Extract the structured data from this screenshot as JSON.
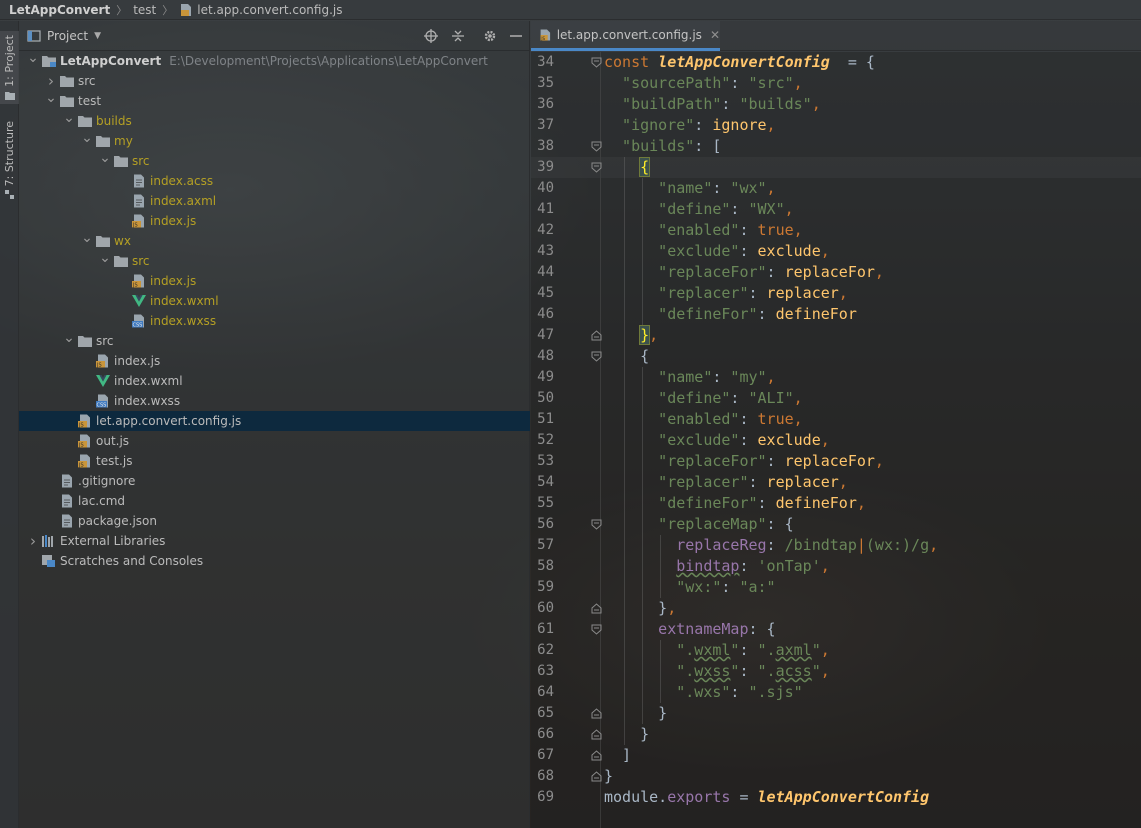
{
  "navbar": {
    "project": "LetAppConvert",
    "folder": "test",
    "file": "let.app.convert.config.js"
  },
  "toolstrip": {
    "project_tab": "1: Project",
    "structure_tab": "7: Structure"
  },
  "project_panel": {
    "title": "Project",
    "icons": [
      "locate-icon",
      "collapse-icon",
      "gear-icon",
      "minimize-icon"
    ],
    "tree": [
      {
        "label": "LetAppConvert",
        "path": "E:\\Development\\Projects\\Applications\\LetAppConvert",
        "type": "project",
        "depth": 0,
        "arrow": "down"
      },
      {
        "label": "src",
        "type": "folder",
        "depth": 1,
        "arrow": "right"
      },
      {
        "label": "test",
        "type": "folder",
        "depth": 1,
        "arrow": "down"
      },
      {
        "label": "builds",
        "type": "folder-excluded",
        "depth": 2,
        "arrow": "down"
      },
      {
        "label": "my",
        "type": "folder-excluded",
        "depth": 3,
        "arrow": "down"
      },
      {
        "label": "src",
        "type": "folder-excluded",
        "depth": 4,
        "arrow": "down"
      },
      {
        "label": "index.acss",
        "type": "file-excluded",
        "depth": 5
      },
      {
        "label": "index.axml",
        "type": "file-excluded",
        "depth": 5
      },
      {
        "label": "index.js",
        "type": "js-excluded",
        "depth": 5
      },
      {
        "label": "wx",
        "type": "folder-excluded",
        "depth": 3,
        "arrow": "down"
      },
      {
        "label": "src",
        "type": "folder-excluded",
        "depth": 4,
        "arrow": "down"
      },
      {
        "label": "index.js",
        "type": "js-excluded",
        "depth": 5
      },
      {
        "label": "index.wxml",
        "type": "vue-excluded",
        "depth": 5
      },
      {
        "label": "index.wxss",
        "type": "css-excluded",
        "depth": 5
      },
      {
        "label": "src",
        "type": "folder",
        "depth": 2,
        "arrow": "down"
      },
      {
        "label": "index.js",
        "type": "js",
        "depth": 3
      },
      {
        "label": "index.wxml",
        "type": "vue",
        "depth": 3
      },
      {
        "label": "index.wxss",
        "type": "css",
        "depth": 3
      },
      {
        "label": "let.app.convert.config.js",
        "type": "js",
        "depth": 2,
        "selected": true
      },
      {
        "label": "out.js",
        "type": "js",
        "depth": 2
      },
      {
        "label": "test.js",
        "type": "js",
        "depth": 2
      },
      {
        "label": ".gitignore",
        "type": "file",
        "depth": 1
      },
      {
        "label": "lac.cmd",
        "type": "file",
        "depth": 1
      },
      {
        "label": "package.json",
        "type": "file",
        "depth": 1
      },
      {
        "label": "External Libraries",
        "type": "libraries",
        "depth": 0,
        "arrow": "right"
      },
      {
        "label": "Scratches and Consoles",
        "type": "scratches",
        "depth": 0
      }
    ]
  },
  "editor": {
    "tab_label": "let.app.convert.config.js",
    "current_line": 39,
    "lines": [
      {
        "n": "34",
        "indent": 0,
        "fold": "open",
        "tokens": [
          [
            "k",
            "const "
          ],
          [
            "f",
            "letAppConvertConfig"
          ],
          [
            "",
            "  = {"
          ]
        ]
      },
      {
        "n": "35",
        "indent": 1,
        "tokens": [
          [
            "s",
            "\"sourcePath\""
          ],
          [
            "",
            ": "
          ],
          [
            "s",
            "\"src\""
          ],
          [
            "k",
            ","
          ]
        ]
      },
      {
        "n": "36",
        "indent": 1,
        "tokens": [
          [
            "s",
            "\"buildPath\""
          ],
          [
            "",
            ": "
          ],
          [
            "s",
            "\"builds\""
          ],
          [
            "k",
            ","
          ]
        ]
      },
      {
        "n": "37",
        "indent": 1,
        "tokens": [
          [
            "s",
            "\"ignore\""
          ],
          [
            "",
            ": "
          ],
          [
            "id",
            "ignore"
          ],
          [
            "k",
            ","
          ]
        ]
      },
      {
        "n": "38",
        "indent": 1,
        "fold": "open",
        "tokens": [
          [
            "s",
            "\"builds\""
          ],
          [
            "",
            ": ["
          ]
        ]
      },
      {
        "n": "39",
        "indent": 2,
        "fold": "open",
        "tokens": [
          [
            "hl",
            "{"
          ]
        ]
      },
      {
        "n": "40",
        "indent": 3,
        "tokens": [
          [
            "s",
            "\"name\""
          ],
          [
            "",
            ": "
          ],
          [
            "s",
            "\"wx\""
          ],
          [
            "k",
            ","
          ]
        ]
      },
      {
        "n": "41",
        "indent": 3,
        "tokens": [
          [
            "s",
            "\"define\""
          ],
          [
            "",
            ": "
          ],
          [
            "s",
            "\"WX\""
          ],
          [
            "k",
            ","
          ]
        ]
      },
      {
        "n": "42",
        "indent": 3,
        "tokens": [
          [
            "s",
            "\"enabled\""
          ],
          [
            "",
            ": "
          ],
          [
            "k",
            "true"
          ],
          [
            "k",
            ","
          ]
        ]
      },
      {
        "n": "43",
        "indent": 3,
        "tokens": [
          [
            "s",
            "\"exclude\""
          ],
          [
            "",
            ": "
          ],
          [
            "id",
            "exclude"
          ],
          [
            "k",
            ","
          ]
        ]
      },
      {
        "n": "44",
        "indent": 3,
        "tokens": [
          [
            "s",
            "\"replaceFor\""
          ],
          [
            "",
            ": "
          ],
          [
            "id",
            "replaceFor"
          ],
          [
            "k",
            ","
          ]
        ]
      },
      {
        "n": "45",
        "indent": 3,
        "tokens": [
          [
            "s",
            "\"replacer\""
          ],
          [
            "",
            ": "
          ],
          [
            "id",
            "replacer"
          ],
          [
            "k",
            ","
          ]
        ]
      },
      {
        "n": "46",
        "indent": 3,
        "tokens": [
          [
            "s",
            "\"defineFor\""
          ],
          [
            "",
            ": "
          ],
          [
            "id",
            "defineFor"
          ]
        ]
      },
      {
        "n": "47",
        "indent": 2,
        "fold": "close",
        "tokens": [
          [
            "hl",
            "}"
          ],
          [
            "k",
            ","
          ]
        ]
      },
      {
        "n": "48",
        "indent": 2,
        "fold": "open",
        "tokens": [
          [
            "",
            "{"
          ]
        ]
      },
      {
        "n": "49",
        "indent": 3,
        "tokens": [
          [
            "s",
            "\"name\""
          ],
          [
            "",
            ": "
          ],
          [
            "s",
            "\"my\""
          ],
          [
            "k",
            ","
          ]
        ]
      },
      {
        "n": "50",
        "indent": 3,
        "tokens": [
          [
            "s",
            "\"define\""
          ],
          [
            "",
            ": "
          ],
          [
            "s",
            "\"ALI\""
          ],
          [
            "k",
            ","
          ]
        ]
      },
      {
        "n": "51",
        "indent": 3,
        "tokens": [
          [
            "s",
            "\"enabled\""
          ],
          [
            "",
            ": "
          ],
          [
            "k",
            "true"
          ],
          [
            "k",
            ","
          ]
        ]
      },
      {
        "n": "52",
        "indent": 3,
        "tokens": [
          [
            "s",
            "\"exclude\""
          ],
          [
            "",
            ": "
          ],
          [
            "id",
            "exclude"
          ],
          [
            "k",
            ","
          ]
        ]
      },
      {
        "n": "53",
        "indent": 3,
        "tokens": [
          [
            "s",
            "\"replaceFor\""
          ],
          [
            "",
            ": "
          ],
          [
            "id",
            "replaceFor"
          ],
          [
            "k",
            ","
          ]
        ]
      },
      {
        "n": "54",
        "indent": 3,
        "tokens": [
          [
            "s",
            "\"replacer\""
          ],
          [
            "",
            ": "
          ],
          [
            "id",
            "replacer"
          ],
          [
            "k",
            ","
          ]
        ]
      },
      {
        "n": "55",
        "indent": 3,
        "tokens": [
          [
            "s",
            "\"defineFor\""
          ],
          [
            "",
            ": "
          ],
          [
            "id",
            "defineFor"
          ],
          [
            "k",
            ","
          ]
        ]
      },
      {
        "n": "56",
        "indent": 3,
        "fold": "open",
        "tokens": [
          [
            "s",
            "\"replaceMap\""
          ],
          [
            "",
            ": {"
          ]
        ]
      },
      {
        "n": "57",
        "indent": 4,
        "tokens": [
          [
            "pl",
            "replaceReg"
          ],
          [
            "",
            ": "
          ],
          [
            "rx",
            "/bindtap"
          ],
          [
            "rxb",
            "|"
          ],
          [
            "rx",
            "(wx:)/g"
          ],
          [
            "k",
            ","
          ]
        ]
      },
      {
        "n": "58",
        "indent": 4,
        "tokens": [
          [
            "pl sq",
            "bindtap"
          ],
          [
            "",
            ": "
          ],
          [
            "s",
            "'onTap'"
          ],
          [
            "k",
            ","
          ]
        ]
      },
      {
        "n": "59",
        "indent": 4,
        "tokens": [
          [
            "s",
            "\"wx:\""
          ],
          [
            "",
            ": "
          ],
          [
            "s",
            "\"a:\""
          ]
        ]
      },
      {
        "n": "60",
        "indent": 3,
        "fold": "close",
        "tokens": [
          [
            "",
            "}"
          ],
          [
            "k",
            ","
          ]
        ]
      },
      {
        "n": "61",
        "indent": 3,
        "fold": "open",
        "tokens": [
          [
            "pl",
            "extnameMap"
          ],
          [
            "",
            ": {"
          ]
        ]
      },
      {
        "n": "62",
        "indent": 4,
        "tokens": [
          [
            "s",
            "\"."
          ],
          [
            "s sq",
            "wxml"
          ],
          [
            "s",
            "\""
          ],
          [
            "",
            ": "
          ],
          [
            "s",
            "\"."
          ],
          [
            "s sq",
            "axml"
          ],
          [
            "s",
            "\""
          ],
          [
            "k",
            ","
          ]
        ]
      },
      {
        "n": "63",
        "indent": 4,
        "tokens": [
          [
            "s",
            "\"."
          ],
          [
            "s sq",
            "wxss"
          ],
          [
            "s",
            "\""
          ],
          [
            "",
            ": "
          ],
          [
            "s",
            "\"."
          ],
          [
            "s sq",
            "acss"
          ],
          [
            "s",
            "\""
          ],
          [
            "k",
            ","
          ]
        ]
      },
      {
        "n": "64",
        "indent": 4,
        "tokens": [
          [
            "s",
            "\".wxs\""
          ],
          [
            "",
            ": "
          ],
          [
            "s",
            "\".sjs\""
          ]
        ]
      },
      {
        "n": "65",
        "indent": 3,
        "fold": "close",
        "tokens": [
          [
            "",
            "}"
          ]
        ]
      },
      {
        "n": "66",
        "indent": 2,
        "fold": "close",
        "tokens": [
          [
            "",
            "}"
          ]
        ]
      },
      {
        "n": "67",
        "indent": 1,
        "fold": "close",
        "tokens": [
          [
            "",
            "]"
          ]
        ]
      },
      {
        "n": "68",
        "indent": 0,
        "fold": "close",
        "tokens": [
          [
            "",
            "}"
          ]
        ]
      },
      {
        "n": "69",
        "indent": 0,
        "tokens": [
          [
            "",
            "module."
          ],
          [
            "p",
            "exports"
          ],
          [
            "",
            " = "
          ],
          [
            "f",
            "letAppConvertConfig"
          ]
        ]
      }
    ]
  },
  "colors": {
    "accent": "#4a88c7",
    "selection": "#0d293e",
    "excluded": "#b5a024",
    "keyword": "#cc7832",
    "string": "#6a8759",
    "property": "#9876aa",
    "function": "#ffc66d"
  }
}
